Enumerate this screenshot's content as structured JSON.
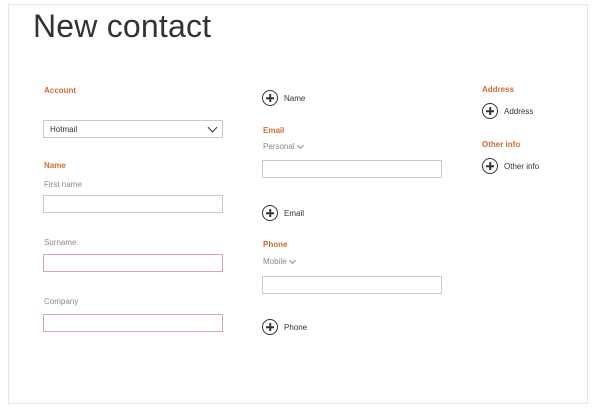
{
  "page": {
    "title": "New contact"
  },
  "left": {
    "account_heading": "Account",
    "account_value": "Hotmail",
    "name_heading": "Name",
    "first_name_label": "First name",
    "surname_label": "Surname",
    "company_label": "Company"
  },
  "middle": {
    "add_name_label": "Name",
    "email_heading": "Email",
    "email_type": "Personal",
    "add_email_label": "Email",
    "phone_heading": "Phone",
    "phone_type": "Mobile",
    "add_phone_label": "Phone"
  },
  "right": {
    "address_heading": "Address",
    "add_address_label": "Address",
    "other_heading": "Other info",
    "add_other_label": "Other info"
  },
  "colors": {
    "section_heading": "#d46a34",
    "field_border": "#c9c9c9",
    "active_border": "#e2a3b1"
  }
}
